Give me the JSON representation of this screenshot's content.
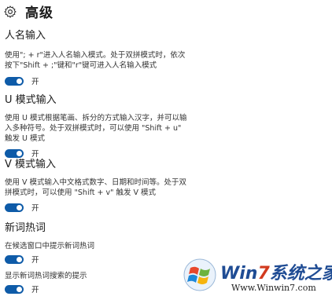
{
  "header": {
    "title": "高级",
    "icon": "gear-icon"
  },
  "sections": [
    {
      "title": "人名输入",
      "desc": "使用\"; + r\"进入人名输入模式。处于双拼模式时，依次按下\"Shift + ;\"键和\"r\"键可进入人名输入模式",
      "toggle": {
        "state": "开",
        "on": true
      }
    },
    {
      "title": "U 模式输入",
      "desc": "使用 U 模式根据笔画、拆分的方式输入汉字，并可以输入多种符号。处于双拼模式时，可以使用 \"Shift + u\" 触发 U 模式",
      "toggle": {
        "state": "开",
        "on": true
      }
    },
    {
      "title": "V 模式输入",
      "desc": "使用 V 模式输入中文格式数字、日期和时间等。处于双拼模式时，可以使用 \"Shift + v\" 触发 V 模式",
      "toggle": {
        "state": "开",
        "on": true
      }
    },
    {
      "title": "新词热词",
      "items": [
        {
          "label": "在候选窗口中提示新词热词",
          "toggle": {
            "state": "开",
            "on": true
          }
        },
        {
          "label": "显示新词热词搜索的提示",
          "toggle": {
            "state": "开",
            "on": true
          }
        }
      ]
    }
  ],
  "watermark": {
    "brand_prefix": "Win",
    "brand_seven": "7",
    "brand_suffix": "系统之家",
    "url": "Www.Winwin7.com"
  },
  "colors": {
    "accent": "#0e5ba8",
    "brand": "#1f4c94",
    "brand_red": "#d23a1e"
  }
}
